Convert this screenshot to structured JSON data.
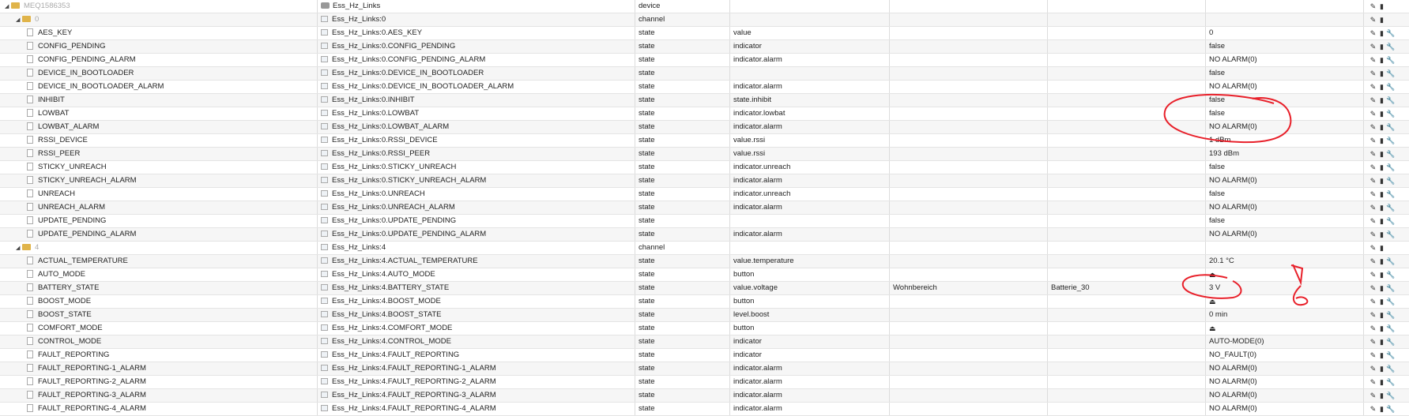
{
  "rows": [
    {
      "name": "MEQ1586353",
      "id": "Ess_Hz_Links",
      "type": "device",
      "role": "",
      "room": "",
      "func": "",
      "value": "",
      "kind": "device",
      "level": 0
    },
    {
      "name": "0",
      "id": "Ess_Hz_Links:0",
      "type": "channel",
      "role": "",
      "room": "",
      "func": "",
      "value": "",
      "kind": "channel",
      "level": 1
    },
    {
      "name": "AES_KEY",
      "id": "Ess_Hz_Links:0.AES_KEY",
      "type": "state",
      "role": "value",
      "room": "",
      "func": "",
      "value": "0",
      "kind": "state",
      "level": 2
    },
    {
      "name": "CONFIG_PENDING",
      "id": "Ess_Hz_Links:0.CONFIG_PENDING",
      "type": "state",
      "role": "indicator",
      "room": "",
      "func": "",
      "value": "false",
      "kind": "state",
      "level": 2
    },
    {
      "name": "CONFIG_PENDING_ALARM",
      "id": "Ess_Hz_Links:0.CONFIG_PENDING_ALARM",
      "type": "state",
      "role": "indicator.alarm",
      "room": "",
      "func": "",
      "value": "NO ALARM(0)",
      "kind": "state",
      "level": 2
    },
    {
      "name": "DEVICE_IN_BOOTLOADER",
      "id": "Ess_Hz_Links:0.DEVICE_IN_BOOTLOADER",
      "type": "state",
      "role": "",
      "room": "",
      "func": "",
      "value": "false",
      "kind": "state",
      "level": 2
    },
    {
      "name": "DEVICE_IN_BOOTLOADER_ALARM",
      "id": "Ess_Hz_Links:0.DEVICE_IN_BOOTLOADER_ALARM",
      "type": "state",
      "role": "indicator.alarm",
      "room": "",
      "func": "",
      "value": "NO ALARM(0)",
      "kind": "state",
      "level": 2
    },
    {
      "name": "INHIBIT",
      "id": "Ess_Hz_Links:0.INHIBIT",
      "type": "state",
      "role": "state.inhibit",
      "room": "",
      "func": "",
      "value": "false",
      "kind": "state",
      "level": 2
    },
    {
      "name": "LOWBAT",
      "id": "Ess_Hz_Links:0.LOWBAT",
      "type": "state",
      "role": "indicator.lowbat",
      "room": "",
      "func": "",
      "value": "false",
      "kind": "state",
      "level": 2
    },
    {
      "name": "LOWBAT_ALARM",
      "id": "Ess_Hz_Links:0.LOWBAT_ALARM",
      "type": "state",
      "role": "indicator.alarm",
      "room": "",
      "func": "",
      "value": "NO ALARM(0)",
      "kind": "state",
      "level": 2
    },
    {
      "name": "RSSI_DEVICE",
      "id": "Ess_Hz_Links:0.RSSI_DEVICE",
      "type": "state",
      "role": "value.rssi",
      "room": "",
      "func": "",
      "value": "1 dBm",
      "kind": "state",
      "level": 2
    },
    {
      "name": "RSSI_PEER",
      "id": "Ess_Hz_Links:0.RSSI_PEER",
      "type": "state",
      "role": "value.rssi",
      "room": "",
      "func": "",
      "value": "193 dBm",
      "kind": "state",
      "level": 2
    },
    {
      "name": "STICKY_UNREACH",
      "id": "Ess_Hz_Links:0.STICKY_UNREACH",
      "type": "state",
      "role": "indicator.unreach",
      "room": "",
      "func": "",
      "value": "false",
      "kind": "state",
      "level": 2
    },
    {
      "name": "STICKY_UNREACH_ALARM",
      "id": "Ess_Hz_Links:0.STICKY_UNREACH_ALARM",
      "type": "state",
      "role": "indicator.alarm",
      "room": "",
      "func": "",
      "value": "NO ALARM(0)",
      "kind": "state",
      "level": 2
    },
    {
      "name": "UNREACH",
      "id": "Ess_Hz_Links:0.UNREACH",
      "type": "state",
      "role": "indicator.unreach",
      "room": "",
      "func": "",
      "value": "false",
      "kind": "state",
      "level": 2
    },
    {
      "name": "UNREACH_ALARM",
      "id": "Ess_Hz_Links:0.UNREACH_ALARM",
      "type": "state",
      "role": "indicator.alarm",
      "room": "",
      "func": "",
      "value": "NO ALARM(0)",
      "kind": "state",
      "level": 2
    },
    {
      "name": "UPDATE_PENDING",
      "id": "Ess_Hz_Links:0.UPDATE_PENDING",
      "type": "state",
      "role": "",
      "room": "",
      "func": "",
      "value": "false",
      "kind": "state",
      "level": 2
    },
    {
      "name": "UPDATE_PENDING_ALARM",
      "id": "Ess_Hz_Links:0.UPDATE_PENDING_ALARM",
      "type": "state",
      "role": "indicator.alarm",
      "room": "",
      "func": "",
      "value": "NO ALARM(0)",
      "kind": "state",
      "level": 2
    },
    {
      "name": "4",
      "id": "Ess_Hz_Links:4",
      "type": "channel",
      "role": "",
      "room": "",
      "func": "",
      "value": "",
      "kind": "channel",
      "level": 1
    },
    {
      "name": "ACTUAL_TEMPERATURE",
      "id": "Ess_Hz_Links:4.ACTUAL_TEMPERATURE",
      "type": "state",
      "role": "value.temperature",
      "room": "",
      "func": "",
      "value": "20.1 °C",
      "kind": "state",
      "level": 2
    },
    {
      "name": "AUTO_MODE",
      "id": "Ess_Hz_Links:4.AUTO_MODE",
      "type": "state",
      "role": "button",
      "room": "",
      "func": "",
      "value": "",
      "kind": "state",
      "level": 2,
      "button": true
    },
    {
      "name": "BATTERY_STATE",
      "id": "Ess_Hz_Links:4.BATTERY_STATE",
      "type": "state",
      "role": "value.voltage",
      "room": "Wohnbereich",
      "func": "Batterie_30",
      "value": "3 V",
      "kind": "state",
      "level": 2
    },
    {
      "name": "BOOST_MODE",
      "id": "Ess_Hz_Links:4.BOOST_MODE",
      "type": "state",
      "role": "button",
      "room": "",
      "func": "",
      "value": "",
      "kind": "state",
      "level": 2,
      "button": true
    },
    {
      "name": "BOOST_STATE",
      "id": "Ess_Hz_Links:4.BOOST_STATE",
      "type": "state",
      "role": "level.boost",
      "room": "",
      "func": "",
      "value": "0 min",
      "kind": "state",
      "level": 2
    },
    {
      "name": "COMFORT_MODE",
      "id": "Ess_Hz_Links:4.COMFORT_MODE",
      "type": "state",
      "role": "button",
      "room": "",
      "func": "",
      "value": "",
      "kind": "state",
      "level": 2,
      "button": true
    },
    {
      "name": "CONTROL_MODE",
      "id": "Ess_Hz_Links:4.CONTROL_MODE",
      "type": "state",
      "role": "indicator",
      "room": "",
      "func": "",
      "value": "AUTO-MODE(0)",
      "kind": "state",
      "level": 2
    },
    {
      "name": "FAULT_REPORTING",
      "id": "Ess_Hz_Links:4.FAULT_REPORTING",
      "type": "state",
      "role": "indicator",
      "room": "",
      "func": "",
      "value": "NO_FAULT(0)",
      "kind": "state",
      "level": 2
    },
    {
      "name": "FAULT_REPORTING-1_ALARM",
      "id": "Ess_Hz_Links:4.FAULT_REPORTING-1_ALARM",
      "type": "state",
      "role": "indicator.alarm",
      "room": "",
      "func": "",
      "value": "NO ALARM(0)",
      "kind": "state",
      "level": 2
    },
    {
      "name": "FAULT_REPORTING-2_ALARM",
      "id": "Ess_Hz_Links:4.FAULT_REPORTING-2_ALARM",
      "type": "state",
      "role": "indicator.alarm",
      "room": "",
      "func": "",
      "value": "NO ALARM(0)",
      "kind": "state",
      "level": 2
    },
    {
      "name": "FAULT_REPORTING-3_ALARM",
      "id": "Ess_Hz_Links:4.FAULT_REPORTING-3_ALARM",
      "type": "state",
      "role": "indicator.alarm",
      "room": "",
      "func": "",
      "value": "NO ALARM(0)",
      "kind": "state",
      "level": 2
    },
    {
      "name": "FAULT_REPORTING-4_ALARM",
      "id": "Ess_Hz_Links:4.FAULT_REPORTING-4_ALARM",
      "type": "state",
      "role": "indicator.alarm",
      "room": "",
      "func": "",
      "value": "NO ALARM(0)",
      "kind": "state",
      "level": 2
    }
  ],
  "icons": {
    "edit": "✎",
    "delete": "▮",
    "settings": "🔧",
    "button": "⏏"
  },
  "colors": {
    "folder": "#e0b44a",
    "annotation": "#e8202a"
  }
}
